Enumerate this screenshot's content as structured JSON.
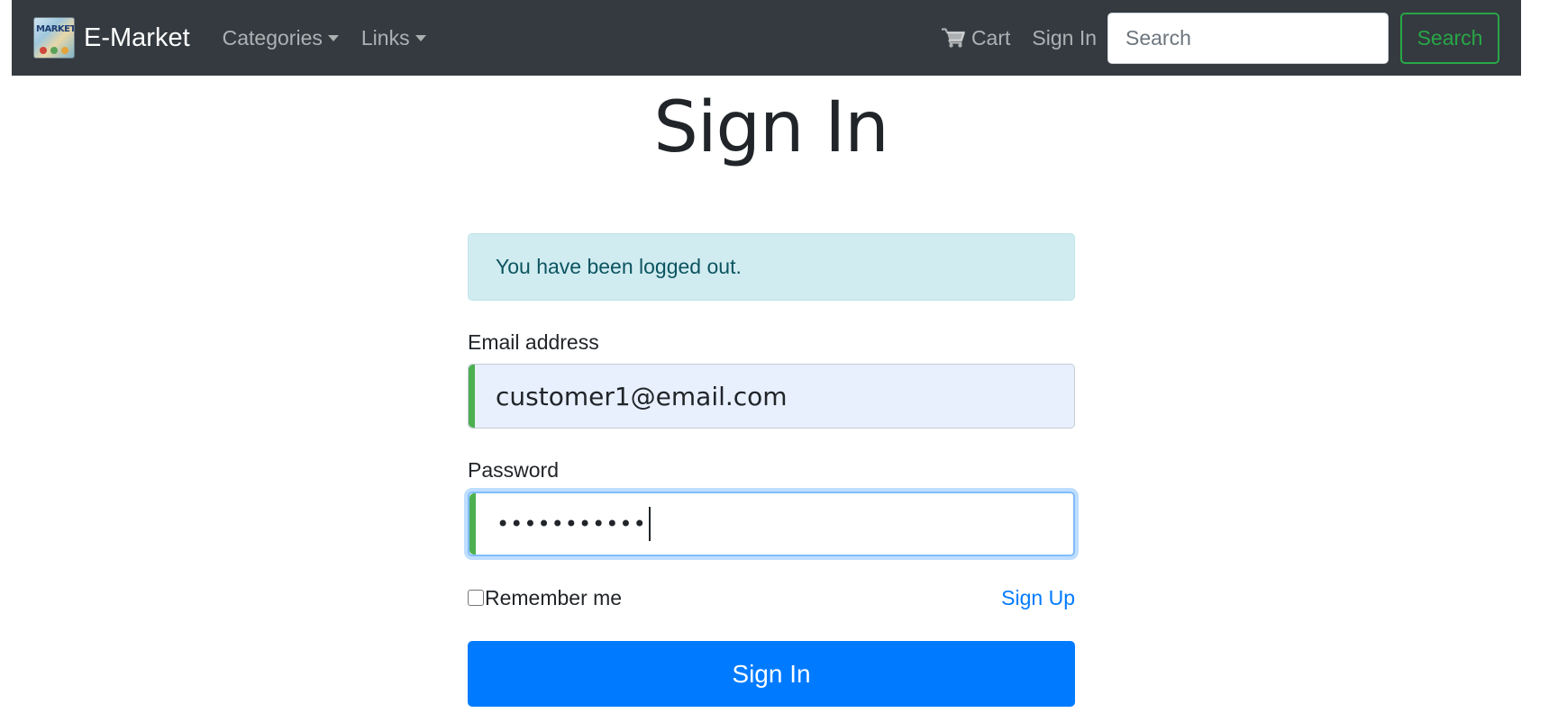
{
  "navbar": {
    "brand_logo_text": "MARKET",
    "brand_name": "E-Market",
    "categories_label": "Categories",
    "links_label": "Links",
    "cart_label": "Cart",
    "signin_label": "Sign In",
    "search_placeholder": "Search",
    "search_button": "Search",
    "background_color": "#343a40",
    "search_button_color": "#28a745"
  },
  "page": {
    "title": "Sign In"
  },
  "alert": {
    "message": "You have been logged out.",
    "background_color": "#d1ecf1"
  },
  "form": {
    "email_label": "Email address",
    "email_value": "customer1@email.com",
    "password_label": "Password",
    "password_masked": "•••••••••••",
    "remember_label": "Remember me",
    "remember_checked": false,
    "signup_label": "Sign Up",
    "submit_label": "Sign In",
    "submit_color": "#007bff",
    "validation_color": "#4caf50"
  },
  "icons": {
    "cart": "cart-icon",
    "caret": "chevron-down-icon"
  }
}
